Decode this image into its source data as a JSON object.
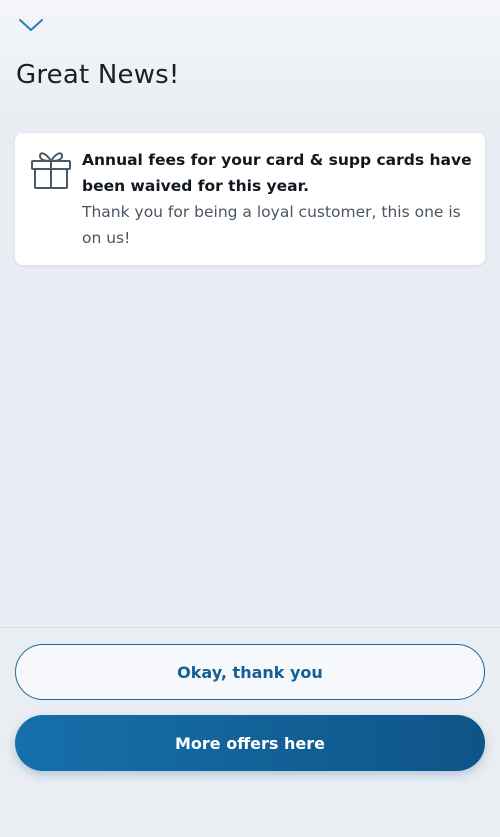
{
  "header": {
    "collapse_icon": "chevron-down-icon",
    "title": "Great News!"
  },
  "notice": {
    "icon": "gift-icon",
    "heading": "Annual fees for your card & supp cards have been waived for this year.",
    "body": "Thank you for being a loyal customer, this one is on us!"
  },
  "actions": {
    "secondary_label": "Okay, thank you",
    "primary_label": "More offers here"
  },
  "colors": {
    "accent": "#145f94",
    "primary_button": "#1167a0",
    "background": "#e9edf3",
    "card": "#ffffff"
  }
}
